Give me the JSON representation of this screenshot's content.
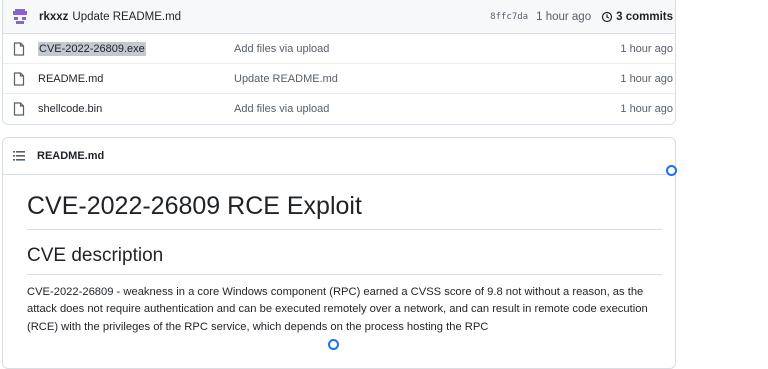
{
  "commit": {
    "author": "rkxxz",
    "message": "Update README.md",
    "sha": "8ffc7da",
    "time": "1 hour ago",
    "commits_label": "3 commits"
  },
  "files": [
    {
      "name": "CVE-2022-26809.exe",
      "message": "Add files via upload",
      "time": "1 hour ago",
      "icon": "file-icon"
    },
    {
      "name": "README.md",
      "message": "Update README.md",
      "time": "1 hour ago",
      "icon": "file-icon"
    },
    {
      "name": "shellcode.bin",
      "message": "Add files via upload",
      "time": "1 hour ago",
      "icon": "file-icon"
    }
  ],
  "readme": {
    "header": "README.md",
    "title": "CVE-2022-26809 RCE Exploit",
    "section": "CVE description",
    "paragraph": "CVE-2022-26809 - weakness in a core Windows component (RPC) earned a CVSS score of 9.8 not without a reason, as the attack does not require authentication and can be executed remotely over a network, and can result in remote code execution (RCE) with the privileges of the RPC service, which depends on the process hosting the RPC"
  },
  "colors": {
    "link": "#0969da",
    "cursor": "#1f6feb",
    "border": "#d8dee4"
  }
}
